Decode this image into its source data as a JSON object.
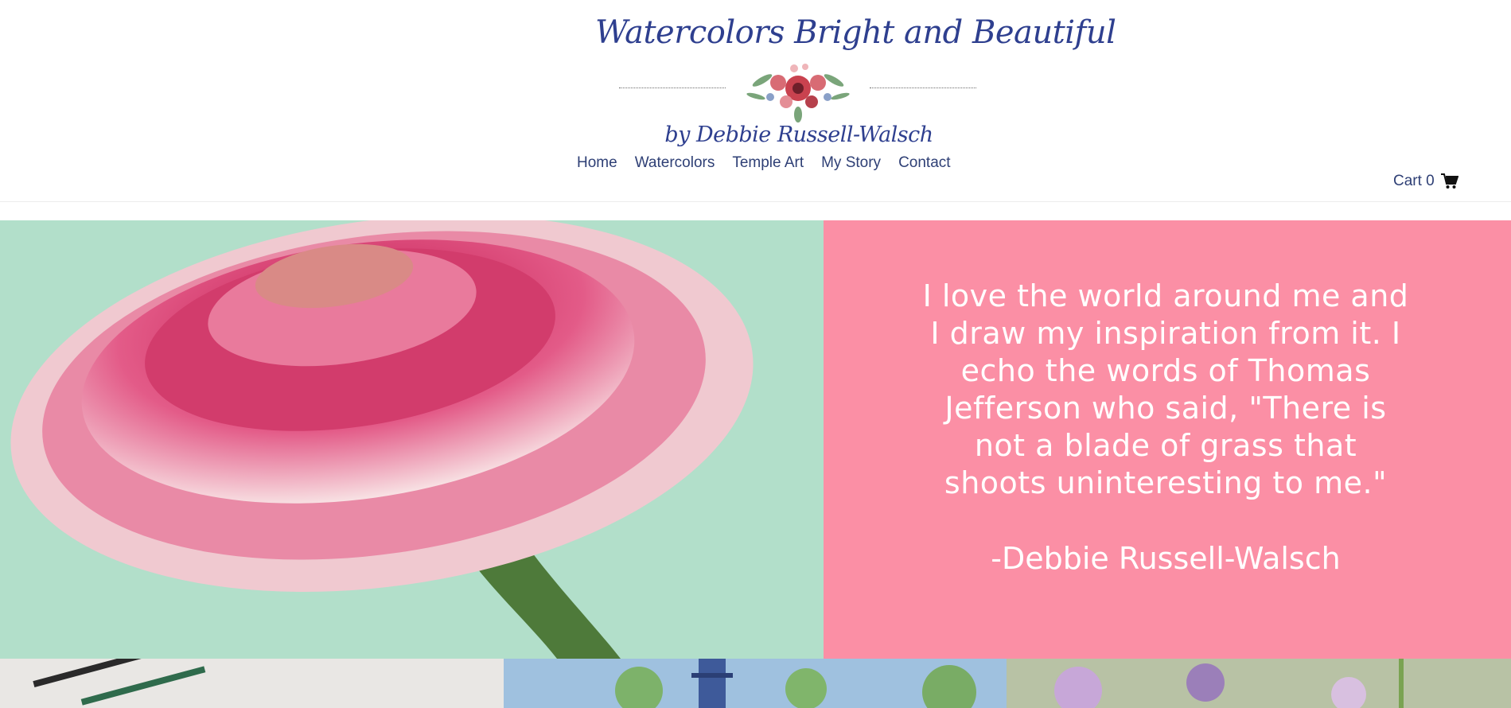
{
  "logo": {
    "title": "Watercolors Bright and Beautiful",
    "byline": "by Debbie Russell-Walsch"
  },
  "nav": {
    "items": [
      "Home",
      "Watercolors",
      "Temple Art",
      "My Story",
      "Contact"
    ]
  },
  "cart": {
    "label": "Cart 0",
    "icon": "cart-icon"
  },
  "hero": {
    "image": "pink-gerbera-daisy-photo",
    "quote": "I love the world around me and I draw my inspiration from it. I echo the words of Thomas Jefferson who said, \"There is not a blade of grass that shoots uninteresting to me.\"",
    "author": "-Debbie Russell-Walsch"
  },
  "colors": {
    "brand_blue": "#2e3f8f",
    "quote_panel": "#fb8fa5",
    "hero_bg": "#b2dfca"
  },
  "gallery": {
    "tiles": [
      "painting-supplies-photo",
      "lighthouse-watercolor",
      "garden-flowers-photo"
    ]
  }
}
